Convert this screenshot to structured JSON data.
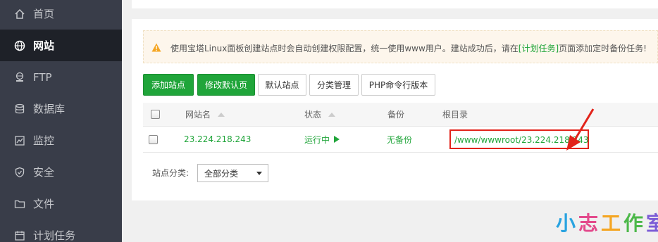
{
  "sidebar": {
    "items": [
      {
        "label": "首页",
        "icon": "home-icon"
      },
      {
        "label": "网站",
        "icon": "globe-icon"
      },
      {
        "label": "FTP",
        "icon": "ftp-icon"
      },
      {
        "label": "数据库",
        "icon": "database-icon"
      },
      {
        "label": "监控",
        "icon": "monitor-icon"
      },
      {
        "label": "安全",
        "icon": "shield-icon"
      },
      {
        "label": "文件",
        "icon": "folder-icon"
      },
      {
        "label": "计划任务",
        "icon": "calendar-icon"
      }
    ],
    "active_index": 1
  },
  "notice": {
    "text_before": "使用宝塔Linux面板创建站点时会自动创建权限配置，统一使用www用户。建站成功后，请在",
    "link": "[计划任务]",
    "text_after": "页面添加定时备份任务!"
  },
  "toolbar": {
    "add_site": "添加站点",
    "edit_default": "修改默认页",
    "default_site": "默认站点",
    "category_manage": "分类管理",
    "php_cli": "PHP命令行版本"
  },
  "table": {
    "headers": {
      "name": "网站名",
      "status": "状态",
      "backup": "备份",
      "root": "根目录"
    },
    "rows": [
      {
        "name": "23.224.218.243",
        "status": "运行中",
        "backup": "无备份",
        "root": "/www/wwwroot/23.224.218.243"
      }
    ]
  },
  "filter": {
    "label": "站点分类:",
    "selected": "全部分类"
  },
  "watermark": {
    "chars": [
      "小",
      "志",
      "工",
      "作",
      "室"
    ],
    "colors": [
      "#29a3e0",
      "#e34a8c",
      "#f5a623",
      "#4cb849",
      "#7b5bd6"
    ]
  },
  "colors": {
    "accent": "#20a53a",
    "highlight": "#e2231a"
  }
}
